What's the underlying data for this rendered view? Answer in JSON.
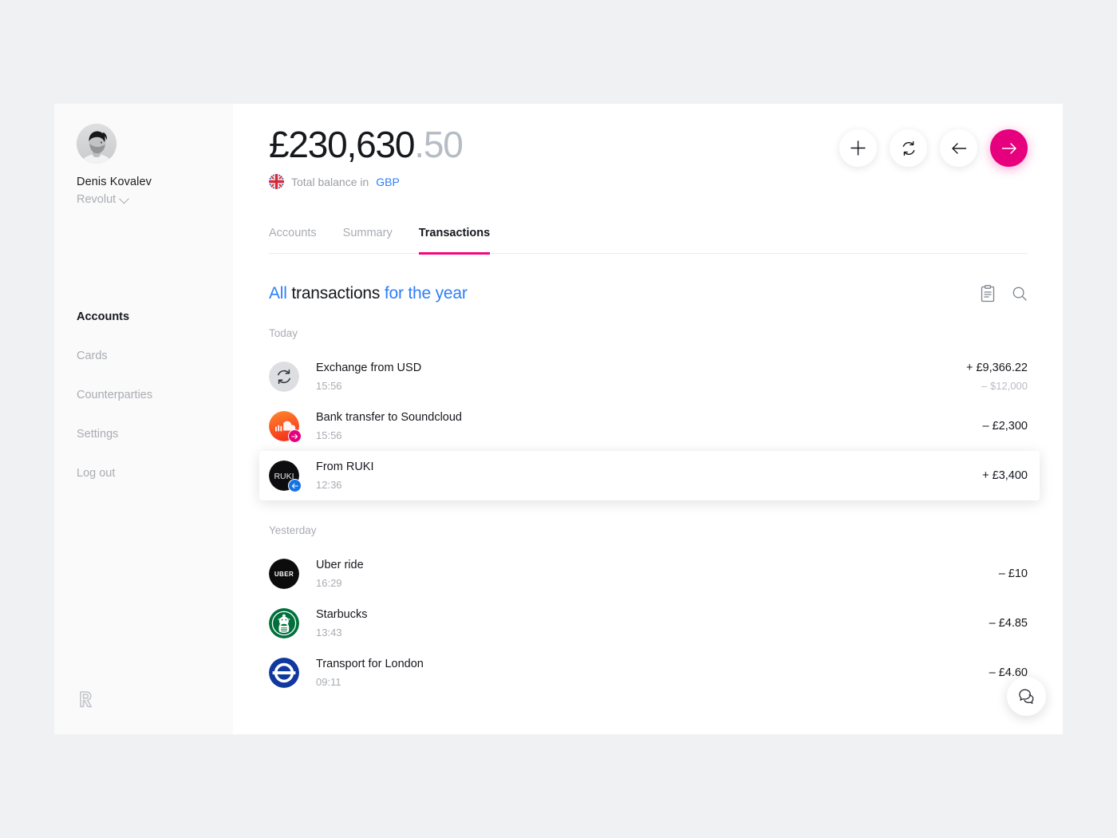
{
  "sidebar": {
    "profile": {
      "name": "Denis Kovalev",
      "org": "Revolut",
      "avatar_icon": "user-avatar-photo",
      "chevron_icon": "chevron-down-icon"
    },
    "items": [
      {
        "label": "Accounts",
        "active": true
      },
      {
        "label": "Cards",
        "active": false
      },
      {
        "label": "Counterparties",
        "active": false
      },
      {
        "label": "Settings",
        "active": false
      },
      {
        "label": "Log out",
        "active": false
      }
    ],
    "footer_logo": "revolut-r-logo"
  },
  "header": {
    "balance_main": "£230,630",
    "balance_cents": ".50",
    "subtitle_prefix": "Total balance in",
    "currency": "GBP",
    "flag_icon": "uk-flag-icon",
    "actions": [
      {
        "name": "add",
        "icon": "plus-icon",
        "label": "Add money"
      },
      {
        "name": "exchange",
        "icon": "exchange-icon",
        "label": "Exchange"
      },
      {
        "name": "request",
        "icon": "arrow-left-icon",
        "label": "Request"
      },
      {
        "name": "send",
        "icon": "arrow-right-icon",
        "label": "Send",
        "primary": true
      }
    ]
  },
  "tabs": [
    {
      "label": "Accounts",
      "active": false
    },
    {
      "label": "Summary",
      "active": false
    },
    {
      "label": "Transactions",
      "active": true
    }
  ],
  "list": {
    "title_all": "All",
    "title_mid": "transactions",
    "title_period": "for the year",
    "tools": [
      {
        "name": "statement",
        "icon": "statement-clipboard-icon"
      },
      {
        "name": "search",
        "icon": "search-icon"
      }
    ]
  },
  "groups": [
    {
      "day": "Today",
      "transactions": [
        {
          "title": "Exchange from USD",
          "time": "15:56",
          "amount": "+ £9,366.22",
          "sub_amount": "– $12,000",
          "icon": "exchange-circle-icon",
          "badge": "none",
          "highlight": false
        },
        {
          "title": "Bank transfer to Soundcloud",
          "time": "15:56",
          "amount": "– £2,300",
          "sub_amount": "",
          "icon": "soundcloud-logo-icon",
          "badge": "outgoing",
          "highlight": false
        },
        {
          "title": "From RUKI",
          "time": "12:36",
          "amount": "+ £3,400",
          "sub_amount": "",
          "icon": "ruki-avatar-icon",
          "avatar_text": "RUKI",
          "badge": "incoming",
          "highlight": true
        }
      ]
    },
    {
      "day": "Yesterday",
      "transactions": [
        {
          "title": "Uber ride",
          "time": "16:29",
          "amount": "– £10",
          "sub_amount": "",
          "icon": "uber-logo-icon",
          "badge": "none",
          "highlight": false
        },
        {
          "title": "Starbucks",
          "time": "13:43",
          "amount": "– £4.85",
          "sub_amount": "",
          "icon": "starbucks-logo-icon",
          "badge": "none",
          "highlight": false
        },
        {
          "title": "Transport for London",
          "time": "09:11",
          "amount": "– £4.60",
          "sub_amount": "",
          "icon": "tfl-logo-icon",
          "badge": "none",
          "highlight": false
        }
      ]
    }
  ],
  "chat": {
    "icon": "chat-bubble-icon"
  },
  "colors": {
    "accent_magenta": "#e6007e",
    "link_blue": "#2d7ff9",
    "text_dark": "#16181d",
    "text_muted": "#a9acb2",
    "page_bg": "#f0f1f2",
    "sidebar_bg": "#fafafa"
  }
}
